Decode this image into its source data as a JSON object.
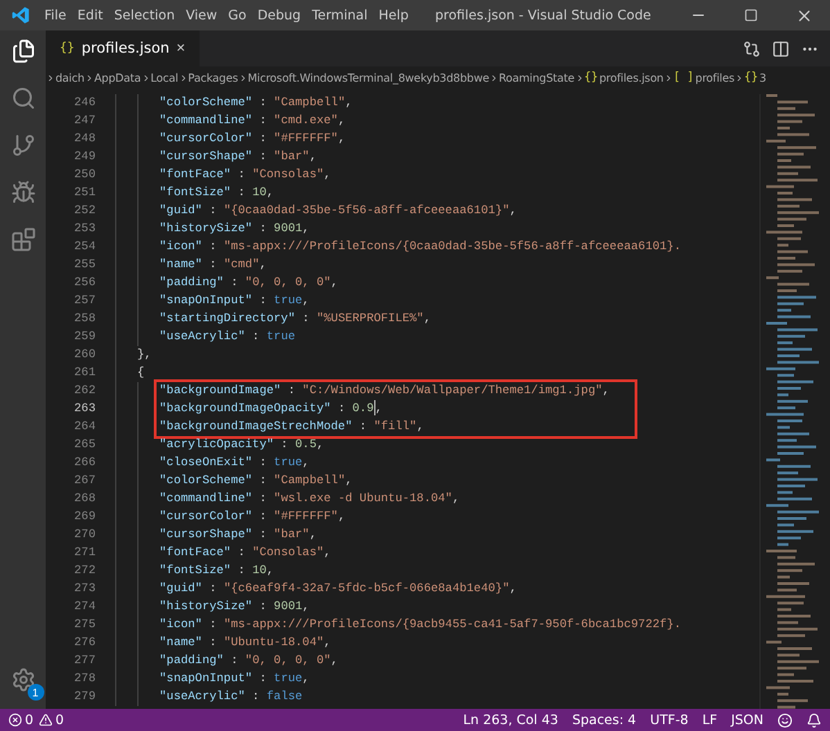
{
  "window": {
    "title": "profiles.json - Visual Studio Code"
  },
  "menu": [
    "File",
    "Edit",
    "Selection",
    "View",
    "Go",
    "Debug",
    "Terminal",
    "Help"
  ],
  "activity_bar": {
    "settings_badge": "1"
  },
  "tabs": [
    {
      "icon": "{}",
      "label": "profiles.json",
      "close": "×",
      "selected": true
    }
  ],
  "breadcrumbs": [
    {
      "label": "daich"
    },
    {
      "label": "AppData"
    },
    {
      "label": "Local"
    },
    {
      "label": "Packages"
    },
    {
      "label": "Microsoft.WindowsTerminal_8wekyb3d8bbwe"
    },
    {
      "label": "RoamingState"
    },
    {
      "icon": "{}",
      "label": "profiles.json"
    },
    {
      "icon": "[ ]",
      "label": "profiles"
    },
    {
      "icon": "{}",
      "label": "3"
    }
  ],
  "editor": {
    "blocks": [
      {
        "kind": "properties",
        "lines": [
          {
            "number": "246",
            "key": "\"colorScheme\"",
            "colon": ":",
            "value": "\"Campbell\"",
            "kind": "string",
            "trailing": ",",
            "current": false
          },
          {
            "number": "247",
            "key": "\"commandline\"",
            "colon": ":",
            "value": "\"cmd.exe\"",
            "kind": "string",
            "trailing": ",",
            "current": false
          },
          {
            "number": "248",
            "key": "\"cursorColor\"",
            "colon": ":",
            "value": "\"#FFFFFF\"",
            "kind": "string",
            "trailing": ",",
            "current": false
          },
          {
            "number": "249",
            "key": "\"cursorShape\"",
            "colon": ":",
            "value": "\"bar\"",
            "kind": "string",
            "trailing": ",",
            "current": false
          },
          {
            "number": "250",
            "key": "\"fontFace\"",
            "colon": ":",
            "value": "\"Consolas\"",
            "kind": "string",
            "trailing": ",",
            "current": false
          },
          {
            "number": "251",
            "key": "\"fontSize\"",
            "colon": ":",
            "value": "10",
            "kind": "number",
            "trailing": ",",
            "current": false
          },
          {
            "number": "252",
            "key": "\"guid\"",
            "colon": ":",
            "value": "\"{0caa0dad-35be-5f56-a8ff-afceeeaa6101}\"",
            "kind": "string",
            "trailing": ",",
            "current": false
          },
          {
            "number": "253",
            "key": "\"historySize\"",
            "colon": ":",
            "value": "9001",
            "kind": "number",
            "trailing": ",",
            "current": false
          },
          {
            "number": "254",
            "key": "\"icon\"",
            "colon": ":",
            "value": "\"ms-appx:///ProfileIcons/{0caa0dad-35be-5f56-a8ff-afceeeaa6101}.",
            "kind": "string",
            "current": false
          },
          {
            "number": "255",
            "key": "\"name\"",
            "colon": ":",
            "value": "\"cmd\"",
            "kind": "string",
            "trailing": ",",
            "current": false
          },
          {
            "number": "256",
            "key": "\"padding\"",
            "colon": ":",
            "value": "\"0, 0, 0, 0\"",
            "kind": "string",
            "trailing": ",",
            "current": false
          },
          {
            "number": "257",
            "key": "\"snapOnInput\"",
            "colon": ":",
            "value": "true",
            "kind": "bool",
            "trailing": ",",
            "current": false
          },
          {
            "number": "258",
            "key": "\"startingDirectory\"",
            "colon": ":",
            "value": "\"%USERPROFILE%\"",
            "kind": "string",
            "trailing": ",",
            "current": false
          },
          {
            "number": "259",
            "key": "\"useAcrylic\"",
            "colon": ":",
            "value": "true",
            "kind": "bool",
            "current": false
          }
        ]
      },
      {
        "kind": "brace",
        "number": "260",
        "text": "},"
      },
      {
        "kind": "brace",
        "number": "261",
        "text": "{"
      },
      {
        "kind": "highlight",
        "lines": [
          {
            "number": "262",
            "key": "\"backgroundImage\"",
            "colon": ":",
            "value": "\"C:/Windows/Web/Wallpaper/Theme1/img1.jpg\"",
            "kind": "string",
            "trailing": ",",
            "current": false
          },
          {
            "number": "263",
            "key": "\"backgroundImageOpacity\"",
            "colon": ":",
            "value": "0.9",
            "kind": "number",
            "trailing": ",",
            "current": true
          },
          {
            "number": "264",
            "key": "\"backgroundImageStrechMode\"",
            "colon": ":",
            "value": "\"fill\"",
            "kind": "string",
            "trailing": ",",
            "current": false
          }
        ]
      },
      {
        "kind": "properties",
        "lines": [
          {
            "number": "265",
            "key": "\"acrylicOpacity\"",
            "colon": ":",
            "value": "0.5",
            "kind": "number",
            "trailing": ",",
            "current": false
          },
          {
            "number": "266",
            "key": "\"closeOnExit\"",
            "colon": ":",
            "value": "true",
            "kind": "bool",
            "trailing": ",",
            "current": false
          },
          {
            "number": "267",
            "key": "\"colorScheme\"",
            "colon": ":",
            "value": "\"Campbell\"",
            "kind": "string",
            "trailing": ",",
            "current": false
          },
          {
            "number": "268",
            "key": "\"commandline\"",
            "colon": ":",
            "value": "\"wsl.exe -d Ubuntu-18.04\"",
            "kind": "string",
            "trailing": ",",
            "current": false
          },
          {
            "number": "269",
            "key": "\"cursorColor\"",
            "colon": ":",
            "value": "\"#FFFFFF\"",
            "kind": "string",
            "trailing": ",",
            "current": false
          },
          {
            "number": "270",
            "key": "\"cursorShape\"",
            "colon": ":",
            "value": "\"bar\"",
            "kind": "string",
            "trailing": ",",
            "current": false
          },
          {
            "number": "271",
            "key": "\"fontFace\"",
            "colon": ":",
            "value": "\"Consolas\"",
            "kind": "string",
            "trailing": ",",
            "current": false
          },
          {
            "number": "272",
            "key": "\"fontSize\"",
            "colon": ":",
            "value": "10",
            "kind": "number",
            "trailing": ",",
            "current": false
          },
          {
            "number": "273",
            "key": "\"guid\"",
            "colon": ":",
            "value": "\"{c6eaf9f4-32a7-5fdc-b5cf-066e8a4b1e40}\"",
            "kind": "string",
            "trailing": ",",
            "current": false
          },
          {
            "number": "274",
            "key": "\"historySize\"",
            "colon": ":",
            "value": "9001",
            "kind": "number",
            "trailing": ",",
            "current": false
          },
          {
            "number": "275",
            "key": "\"icon\"",
            "colon": ":",
            "value": "\"ms-appx:///ProfileIcons/{9acb9455-ca41-5af7-950f-6bca1bc9722f}.",
            "kind": "string",
            "current": false
          },
          {
            "number": "276",
            "key": "\"name\"",
            "colon": ":",
            "value": "\"Ubuntu-18.04\"",
            "kind": "string",
            "trailing": ",",
            "current": false
          },
          {
            "number": "277",
            "key": "\"padding\"",
            "colon": ":",
            "value": "\"0, 0, 0, 0\"",
            "kind": "string",
            "trailing": ",",
            "current": false
          },
          {
            "number": "278",
            "key": "\"snapOnInput\"",
            "colon": ":",
            "value": "true",
            "kind": "bool",
            "trailing": ",",
            "current": false
          },
          {
            "number": "279",
            "key": "\"useAcrylic\"",
            "colon": ":",
            "value": "false",
            "kind": "bool",
            "current": false
          }
        ]
      }
    ]
  },
  "status_bar": {
    "errors": "0",
    "warnings": "0",
    "items": [
      "Ln 263, Col 43",
      "Spaces: 4",
      "UTF-8",
      "LF",
      "JSON"
    ]
  }
}
